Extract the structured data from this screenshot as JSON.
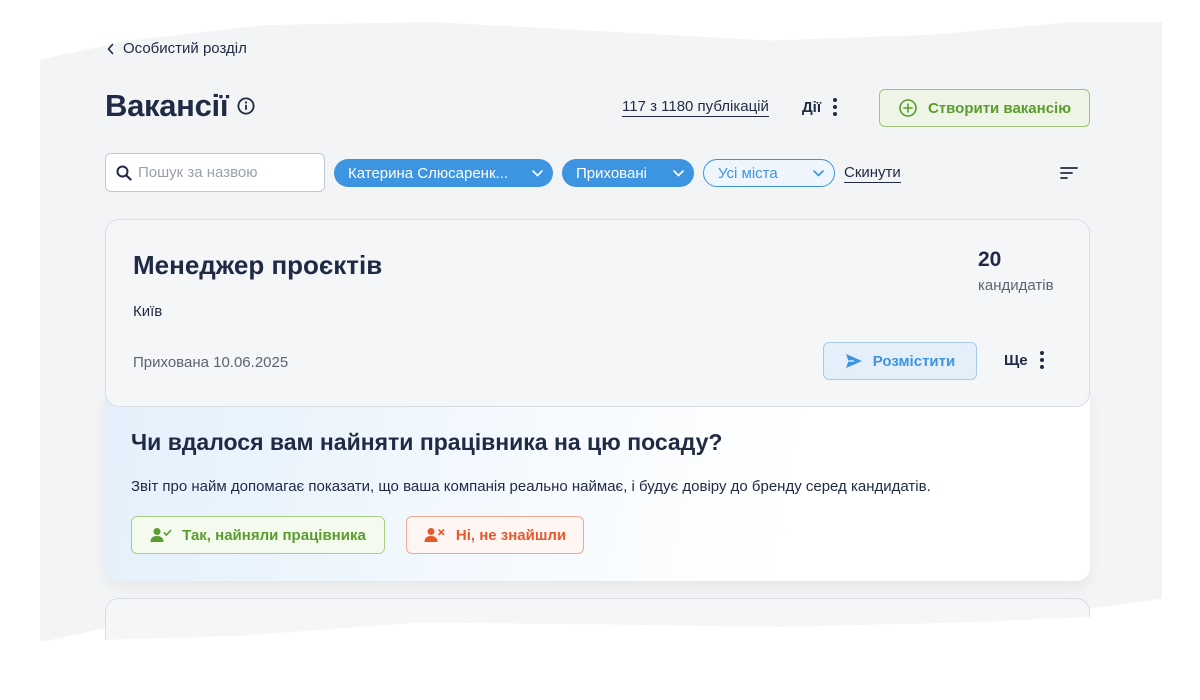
{
  "breadcrumb": {
    "label": "Особистий розділ"
  },
  "header": {
    "title": "Вакансії",
    "publications": "117 з 1180 публікацій",
    "actions_label": "Дії",
    "create_label": "Створити вакансію"
  },
  "filters": {
    "search_placeholder": "Пошук за назвою",
    "recruiter": "Катерина Слюсаренк...",
    "status": "Приховані",
    "city": "Усі міста",
    "reset_label": "Скинути"
  },
  "job": {
    "title": "Менеджер проєктів",
    "city": "Київ",
    "status": "Прихована 10.06.2025",
    "candidates_count": "20",
    "candidates_label": "кандидатів",
    "place_label": "Розмістити",
    "more_label": "Ще"
  },
  "survey": {
    "question": "Чи вдалося вам найняти працівника на цю посаду?",
    "note": "Звіт про найм допомагає показати, що ваша компанія реально наймає, і будує довіру до бренду серед кандидатів.",
    "yes_label": "Так, найняли працівника",
    "no_label": "Ні, не знайшли"
  },
  "colors": {
    "primary_blue": "#3d94e0",
    "success_green": "#5a9c2e",
    "danger_orange": "#e45a2c",
    "text_dark": "#1f2a44"
  }
}
